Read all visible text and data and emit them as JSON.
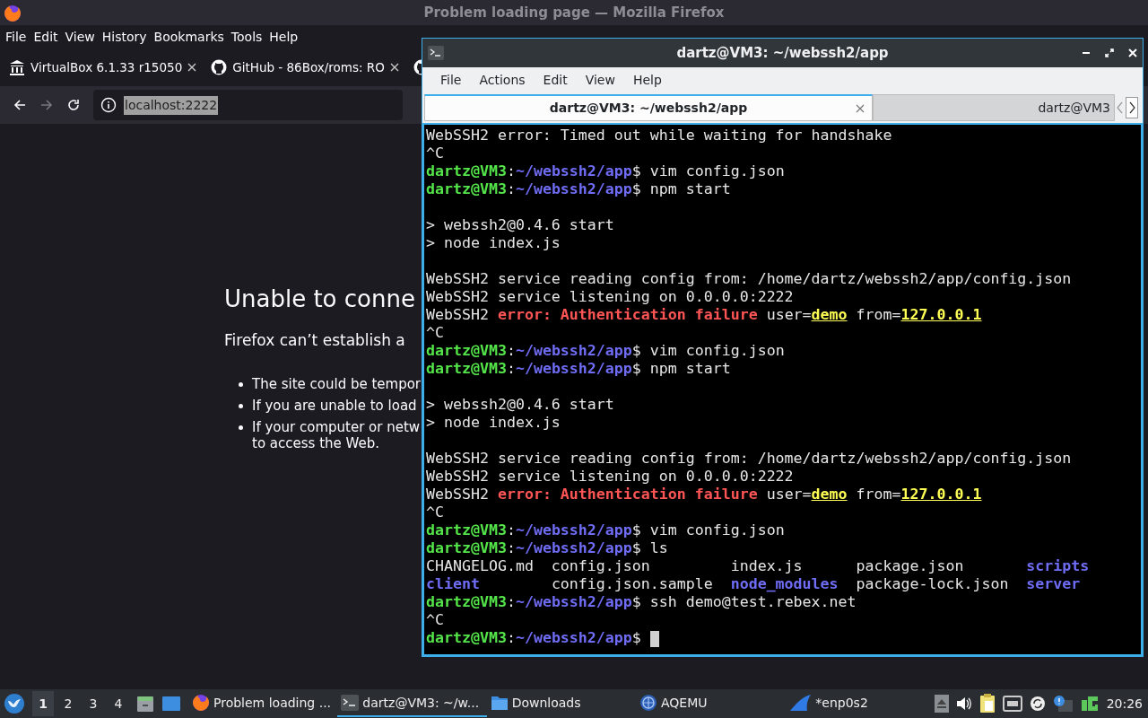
{
  "firefox": {
    "title": "Problem loading page — Mozilla Firefox",
    "menu": [
      "File",
      "Edit",
      "View",
      "History",
      "Bookmarks",
      "Tools",
      "Help"
    ],
    "tabs": [
      {
        "title": "VirtualBox 6.1.33 r15050",
        "kind": "museum"
      },
      {
        "title": "GitHub - 86Box/roms: RO",
        "kind": "github"
      },
      {
        "kind": "github"
      }
    ],
    "url": "localhost:2222",
    "error": {
      "heading": "Unable to conne",
      "message": "Firefox can’t establish a",
      "bullets": [
        [
          "The site could be tempor"
        ],
        [
          "If you are unable to load"
        ],
        [
          "If your computer or netw",
          "to access the Web."
        ]
      ]
    }
  },
  "terminal": {
    "title": "dartz@VM3: ~/webssh2/app",
    "menu": [
      "File",
      "Actions",
      "Edit",
      "View",
      "Help"
    ],
    "tabs": [
      {
        "title": "dartz@VM3: ~/webssh2/app",
        "selected": true
      },
      {
        "title": "dartz@VM3",
        "selected": false
      }
    ],
    "lines": [
      {
        "kind": "text",
        "segs": [
          {
            "t": "WebSSH2 error: Timed out while waiting for handshake",
            "kind": "plain"
          }
        ]
      },
      {
        "kind": "text",
        "segs": [
          {
            "t": "^C",
            "kind": "plain"
          }
        ]
      },
      {
        "kind": "text",
        "segs": [
          {
            "t": "dartz@VM3",
            "kind": "user"
          },
          {
            "t": ":",
            "kind": "plain"
          },
          {
            "t": "~/webssh2/app",
            "kind": "path"
          },
          {
            "t": "$ vim config.json",
            "kind": "plain"
          }
        ]
      },
      {
        "kind": "text",
        "segs": [
          {
            "t": "dartz@VM3",
            "kind": "user"
          },
          {
            "t": ":",
            "kind": "plain"
          },
          {
            "t": "~/webssh2/app",
            "kind": "path"
          },
          {
            "t": "$ npm start",
            "kind": "plain"
          }
        ]
      },
      {
        "kind": "blank"
      },
      {
        "kind": "text",
        "segs": [
          {
            "t": "> webssh2@0.4.6 start",
            "kind": "plain"
          }
        ]
      },
      {
        "kind": "text",
        "segs": [
          {
            "t": "> node index.js",
            "kind": "plain"
          }
        ]
      },
      {
        "kind": "blank"
      },
      {
        "kind": "text",
        "segs": [
          {
            "t": "WebSSH2 service reading config from: /home/dartz/webssh2/app/config.json",
            "kind": "plain"
          }
        ]
      },
      {
        "kind": "text",
        "segs": [
          {
            "t": "WebSSH2 service listening on 0.0.0.0:2222",
            "kind": "plain"
          }
        ]
      },
      {
        "kind": "text",
        "segs": [
          {
            "t": "WebSSH2 ",
            "kind": "plain"
          },
          {
            "t": "error: Authentication failure",
            "kind": "error"
          },
          {
            "t": " user=",
            "kind": "plain"
          },
          {
            "t": "demo",
            "kind": "value"
          },
          {
            "t": " from=",
            "kind": "plain"
          },
          {
            "t": "127.0.0.1",
            "kind": "value"
          }
        ]
      },
      {
        "kind": "text",
        "segs": [
          {
            "t": "^C",
            "kind": "plain"
          }
        ]
      },
      {
        "kind": "text",
        "segs": [
          {
            "t": "dartz@VM3",
            "kind": "user"
          },
          {
            "t": ":",
            "kind": "plain"
          },
          {
            "t": "~/webssh2/app",
            "kind": "path"
          },
          {
            "t": "$ vim config.json",
            "kind": "plain"
          }
        ]
      },
      {
        "kind": "text",
        "segs": [
          {
            "t": "dartz@VM3",
            "kind": "user"
          },
          {
            "t": ":",
            "kind": "plain"
          },
          {
            "t": "~/webssh2/app",
            "kind": "path"
          },
          {
            "t": "$ npm start",
            "kind": "plain"
          }
        ]
      },
      {
        "kind": "blank"
      },
      {
        "kind": "text",
        "segs": [
          {
            "t": "> webssh2@0.4.6 start",
            "kind": "plain"
          }
        ]
      },
      {
        "kind": "text",
        "segs": [
          {
            "t": "> node index.js",
            "kind": "plain"
          }
        ]
      },
      {
        "kind": "blank"
      },
      {
        "kind": "text",
        "segs": [
          {
            "t": "WebSSH2 service reading config from: /home/dartz/webssh2/app/config.json",
            "kind": "plain"
          }
        ]
      },
      {
        "kind": "text",
        "segs": [
          {
            "t": "WebSSH2 service listening on 0.0.0.0:2222",
            "kind": "plain"
          }
        ]
      },
      {
        "kind": "text",
        "segs": [
          {
            "t": "WebSSH2 ",
            "kind": "plain"
          },
          {
            "t": "error: Authentication failure",
            "kind": "error"
          },
          {
            "t": " user=",
            "kind": "plain"
          },
          {
            "t": "demo",
            "kind": "value"
          },
          {
            "t": " from=",
            "kind": "plain"
          },
          {
            "t": "127.0.0.1",
            "kind": "value"
          }
        ]
      },
      {
        "kind": "text",
        "segs": [
          {
            "t": "^C",
            "kind": "plain"
          }
        ]
      },
      {
        "kind": "text",
        "segs": [
          {
            "t": "dartz@VM3",
            "kind": "user"
          },
          {
            "t": ":",
            "kind": "plain"
          },
          {
            "t": "~/webssh2/app",
            "kind": "path"
          },
          {
            "t": "$ vim config.json",
            "kind": "plain"
          }
        ]
      },
      {
        "kind": "text",
        "segs": [
          {
            "t": "dartz@VM3",
            "kind": "user"
          },
          {
            "t": ":",
            "kind": "plain"
          },
          {
            "t": "~/webssh2/app",
            "kind": "path"
          },
          {
            "t": "$ ls",
            "kind": "plain"
          }
        ]
      },
      {
        "kind": "columns",
        "cells": [
          {
            "t": "CHANGELOG.md",
            "kind": "plain"
          },
          {
            "t": "config.json",
            "kind": "plain"
          },
          {
            "t": "index.js",
            "kind": "plain"
          },
          {
            "t": "package.json",
            "kind": "plain"
          },
          {
            "t": "scripts",
            "kind": "dir"
          }
        ]
      },
      {
        "kind": "columns",
        "cells": [
          {
            "t": "client",
            "kind": "dir"
          },
          {
            "t": "config.json.sample",
            "kind": "plain"
          },
          {
            "t": "node_modules",
            "kind": "dir"
          },
          {
            "t": "package-lock.json",
            "kind": "plain"
          },
          {
            "t": "server",
            "kind": "dir"
          }
        ]
      },
      {
        "kind": "text",
        "segs": [
          {
            "t": "dartz@VM3",
            "kind": "user"
          },
          {
            "t": ":",
            "kind": "plain"
          },
          {
            "t": "~/webssh2/app",
            "kind": "path"
          },
          {
            "t": "$ ssh demo@test.rebex.net",
            "kind": "plain"
          }
        ]
      },
      {
        "kind": "text",
        "segs": [
          {
            "t": "^C",
            "kind": "plain"
          }
        ]
      },
      {
        "kind": "text",
        "cursor": true,
        "segs": [
          {
            "t": "dartz@VM3",
            "kind": "user"
          },
          {
            "t": ":",
            "kind": "plain"
          },
          {
            "t": "~/webssh2/app",
            "kind": "path"
          },
          {
            "t": "$",
            "kind": "plain"
          }
        ]
      }
    ]
  },
  "taskbar": {
    "desktops": [
      {
        "label": "1",
        "selected": true
      },
      {
        "label": "2",
        "selected": false
      },
      {
        "label": "3",
        "selected": false
      },
      {
        "label": "4",
        "selected": false
      }
    ],
    "tasks": [
      {
        "label": "Problem loading ...",
        "kind": "firefox",
        "selected": false
      },
      {
        "label": "dartz@VM3: ~/w...",
        "kind": "terminal",
        "selected": true
      },
      {
        "label": "Downloads",
        "kind": "folder",
        "selected": false
      },
      {
        "label": "AQEMU",
        "kind": "globe",
        "selected": false
      },
      {
        "label": "*enp0s2",
        "kind": "fin",
        "selected": false
      }
    ],
    "clock": "20:26"
  }
}
